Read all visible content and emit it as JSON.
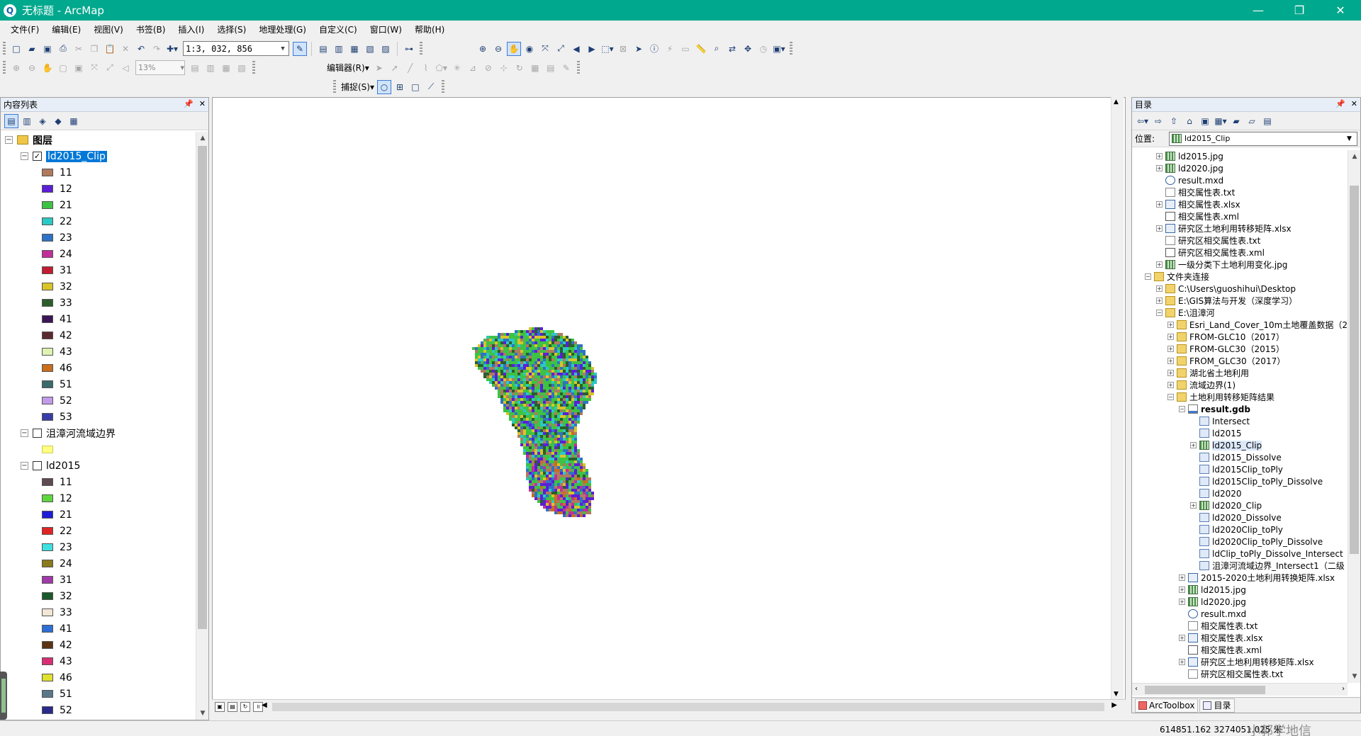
{
  "window": {
    "title": "无标题 - ArcMap",
    "minimize": "—",
    "restore": "❐",
    "close": "✕"
  },
  "menu": [
    "文件(F)",
    "编辑(E)",
    "视图(V)",
    "书签(B)",
    "插入(I)",
    "选择(S)",
    "地理处理(G)",
    "自定义(C)",
    "窗口(W)",
    "帮助(H)"
  ],
  "toolbar": {
    "scale": "1:3, 032, 856",
    "zoom_percent": "13%",
    "editor_label": "编辑器(R)▾",
    "snap_label": "捕捉(S)▾"
  },
  "toc": {
    "header": "内容列表",
    "root_label": "图层",
    "layer1": {
      "name": "ld2015_Clip",
      "checked": true,
      "classes": [
        {
          "label": "11",
          "color": "#b07a5e"
        },
        {
          "label": "12",
          "color": "#5b1fd6"
        },
        {
          "label": "21",
          "color": "#3ec244"
        },
        {
          "label": "22",
          "color": "#2cc8c3"
        },
        {
          "label": "23",
          "color": "#2f72c4"
        },
        {
          "label": "24",
          "color": "#c0309a"
        },
        {
          "label": "31",
          "color": "#c11d33"
        },
        {
          "label": "32",
          "color": "#d9c42a"
        },
        {
          "label": "33",
          "color": "#2b5e2b"
        },
        {
          "label": "41",
          "color": "#3a1656"
        },
        {
          "label": "42",
          "color": "#5a2a2e"
        },
        {
          "label": "43",
          "color": "#dff2b2"
        },
        {
          "label": "46",
          "color": "#c96e1f"
        },
        {
          "label": "51",
          "color": "#3c6b6b"
        },
        {
          "label": "52",
          "color": "#c39be8"
        },
        {
          "label": "53",
          "color": "#3a3ca8"
        }
      ]
    },
    "layer2": {
      "name": "沮漳河流域边界",
      "checked": false,
      "color": "#ffff80"
    },
    "layer3": {
      "name": "ld2015",
      "checked": false,
      "classes": [
        {
          "label": "11",
          "color": "#5e4a52"
        },
        {
          "label": "12",
          "color": "#5fd63e"
        },
        {
          "label": "21",
          "color": "#1e1ed6"
        },
        {
          "label": "22",
          "color": "#e02424"
        },
        {
          "label": "23",
          "color": "#3ee0e0"
        },
        {
          "label": "24",
          "color": "#8a7a1c"
        },
        {
          "label": "31",
          "color": "#a03aa8"
        },
        {
          "label": "32",
          "color": "#1a5a2a"
        },
        {
          "label": "33",
          "color": "#f2e6d6"
        },
        {
          "label": "41",
          "color": "#2e6ed6"
        },
        {
          "label": "42",
          "color": "#5a3414"
        },
        {
          "label": "43",
          "color": "#d82e74"
        },
        {
          "label": "46",
          "color": "#e0e030"
        },
        {
          "label": "51",
          "color": "#5a7888"
        },
        {
          "label": "52",
          "color": "#2a2a8a"
        }
      ]
    }
  },
  "catalog": {
    "header": "目录",
    "location_label": "位置:",
    "location_value": "ld2015_Clip",
    "items": [
      {
        "label": "ld2015.jpg",
        "indent": 1,
        "icon": "raster",
        "exp": "+"
      },
      {
        "label": "ld2020.jpg",
        "indent": 1,
        "icon": "raster",
        "exp": "+"
      },
      {
        "label": "result.mxd",
        "indent": 1,
        "icon": "mxd",
        "exp": ""
      },
      {
        "label": "相交属性表.txt",
        "indent": 1,
        "icon": "doc",
        "exp": ""
      },
      {
        "label": "相交属性表.xlsx",
        "indent": 1,
        "icon": "xls",
        "exp": "+"
      },
      {
        "label": "相交属性表.xml",
        "indent": 1,
        "icon": "xml",
        "exp": ""
      },
      {
        "label": "研究区土地利用转移矩阵.xlsx",
        "indent": 1,
        "icon": "xls",
        "exp": "+"
      },
      {
        "label": "研究区相交属性表.txt",
        "indent": 1,
        "icon": "doc",
        "exp": ""
      },
      {
        "label": "研究区相交属性表.xml",
        "indent": 1,
        "icon": "xml",
        "exp": ""
      },
      {
        "label": "一级分类下土地利用变化.jpg",
        "indent": 1,
        "icon": "raster",
        "exp": "+"
      },
      {
        "label": "文件夹连接",
        "indent": 0,
        "icon": "folder",
        "exp": "−"
      },
      {
        "label": "C:\\Users\\guoshihui\\Desktop",
        "indent": 1,
        "icon": "folder",
        "exp": "+"
      },
      {
        "label": "E:\\GIS算法与开发（深度学习）",
        "indent": 1,
        "icon": "folder",
        "exp": "+"
      },
      {
        "label": "E:\\沮漳河",
        "indent": 1,
        "icon": "folder",
        "exp": "−"
      },
      {
        "label": "Esri_Land_Cover_10m土地覆盖数据（2",
        "indent": 2,
        "icon": "folder",
        "exp": "+"
      },
      {
        "label": "FROM-GLC10（2017）",
        "indent": 2,
        "icon": "folder",
        "exp": "+"
      },
      {
        "label": "FROM-GLC30（2015）",
        "indent": 2,
        "icon": "folder",
        "exp": "+"
      },
      {
        "label": "FROM_GLC30（2017）",
        "indent": 2,
        "icon": "folder",
        "exp": "+"
      },
      {
        "label": "湖北省土地利用",
        "indent": 2,
        "icon": "folder",
        "exp": "+"
      },
      {
        "label": "流域边界(1)",
        "indent": 2,
        "icon": "folder",
        "exp": "+"
      },
      {
        "label": "土地利用转移矩阵结果",
        "indent": 2,
        "icon": "folder",
        "exp": "−"
      },
      {
        "label": "result.gdb",
        "indent": 3,
        "icon": "gdb",
        "exp": "−",
        "bold": true
      },
      {
        "label": "Intersect",
        "indent": 4,
        "icon": "feature",
        "exp": ""
      },
      {
        "label": "ld2015",
        "indent": 4,
        "icon": "feature",
        "exp": ""
      },
      {
        "label": "ld2015_Clip",
        "indent": 4,
        "icon": "raster",
        "exp": "+",
        "hl": true
      },
      {
        "label": "ld2015_Dissolve",
        "indent": 4,
        "icon": "feature",
        "exp": ""
      },
      {
        "label": "ld2015Clip_toPly",
        "indent": 4,
        "icon": "feature",
        "exp": ""
      },
      {
        "label": "ld2015Clip_toPly_Dissolve",
        "indent": 4,
        "icon": "feature",
        "exp": ""
      },
      {
        "label": "ld2020",
        "indent": 4,
        "icon": "feature",
        "exp": ""
      },
      {
        "label": "ld2020_Clip",
        "indent": 4,
        "icon": "raster",
        "exp": "+"
      },
      {
        "label": "ld2020_Dissolve",
        "indent": 4,
        "icon": "feature",
        "exp": ""
      },
      {
        "label": "ld2020Clip_toPly",
        "indent": 4,
        "icon": "feature",
        "exp": ""
      },
      {
        "label": "ld2020Clip_toPly_Dissolve",
        "indent": 4,
        "icon": "feature",
        "exp": ""
      },
      {
        "label": "ldClip_toPly_Dissolve_Intersect",
        "indent": 4,
        "icon": "feature",
        "exp": ""
      },
      {
        "label": "沮漳河流域边界_Intersect1（二级",
        "indent": 4,
        "icon": "feature",
        "exp": ""
      },
      {
        "label": "2015-2020土地利用转换矩阵.xlsx",
        "indent": 3,
        "icon": "xls",
        "exp": "+"
      },
      {
        "label": "ld2015.jpg",
        "indent": 3,
        "icon": "raster",
        "exp": "+"
      },
      {
        "label": "ld2020.jpg",
        "indent": 3,
        "icon": "raster",
        "exp": "+"
      },
      {
        "label": "result.mxd",
        "indent": 3,
        "icon": "mxd",
        "exp": ""
      },
      {
        "label": "相交属性表.txt",
        "indent": 3,
        "icon": "doc",
        "exp": ""
      },
      {
        "label": "相交属性表.xlsx",
        "indent": 3,
        "icon": "xls",
        "exp": "+"
      },
      {
        "label": "相交属性表.xml",
        "indent": 3,
        "icon": "xml",
        "exp": ""
      },
      {
        "label": "研究区土地利用转移矩阵.xlsx",
        "indent": 3,
        "icon": "xls",
        "exp": "+"
      },
      {
        "label": "研究区相交属性表.txt",
        "indent": 3,
        "icon": "doc",
        "exp": ""
      }
    ],
    "tab_toolbox": "ArcToolbox",
    "tab_catalog": "目录"
  },
  "status": {
    "coordinates": "614851.162  3274051.025 米",
    "watermark": "小郭学地信"
  }
}
